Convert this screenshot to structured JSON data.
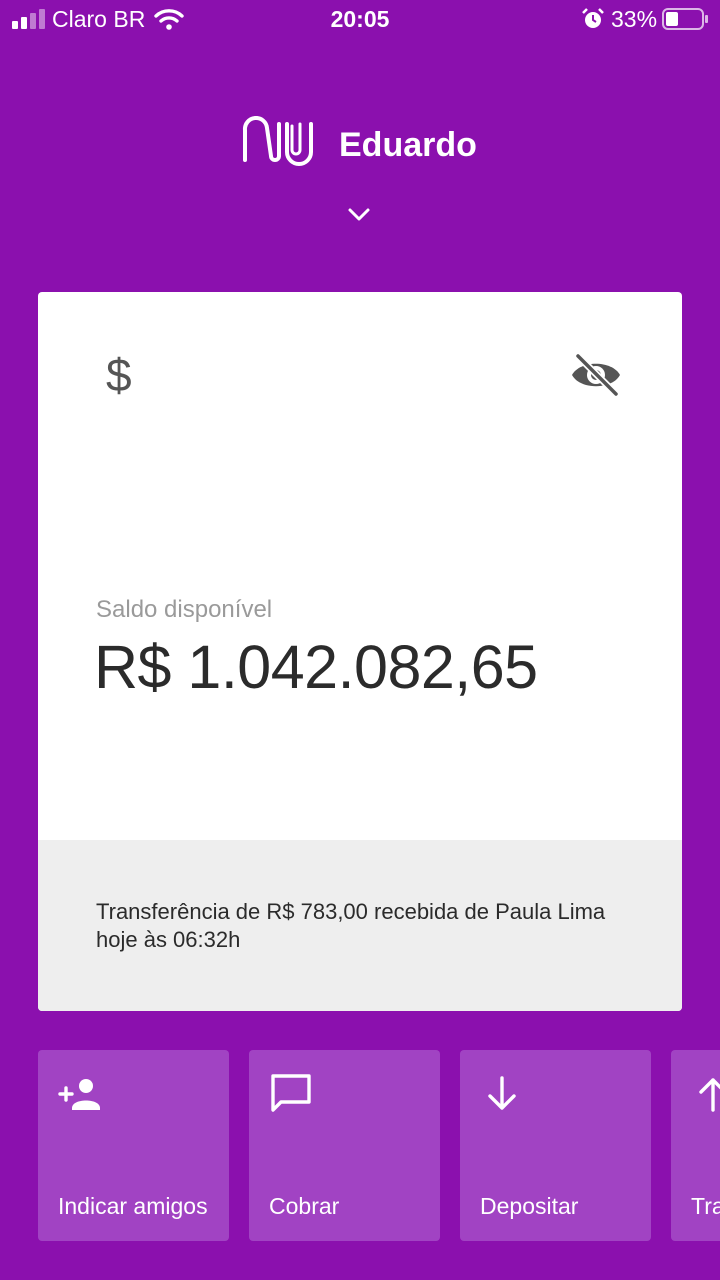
{
  "status_bar": {
    "carrier": "Claro BR",
    "time": "20:05",
    "battery_percent": "33%"
  },
  "header": {
    "user_name": "Eduardo"
  },
  "account_card": {
    "balance_label": "Saldo disponível",
    "balance_value": "R$ 1.042.082,65",
    "notice": "Transferência de R$ 783,00 recebida de Paula Lima hoje às 06:32h"
  },
  "shortcuts": [
    {
      "label": "Indicar amigos",
      "icon": "add-person-icon"
    },
    {
      "label": "Cobrar",
      "icon": "chat-bubble-icon"
    },
    {
      "label": "Depositar",
      "icon": "arrow-down-icon"
    },
    {
      "label": "Tra",
      "icon": "arrow-up-icon"
    }
  ],
  "colors": {
    "background": "#8B10AE",
    "shortcut_tile": "#A143C3",
    "card": "#FFFFFF",
    "card_footer": "#EEEEEE"
  }
}
